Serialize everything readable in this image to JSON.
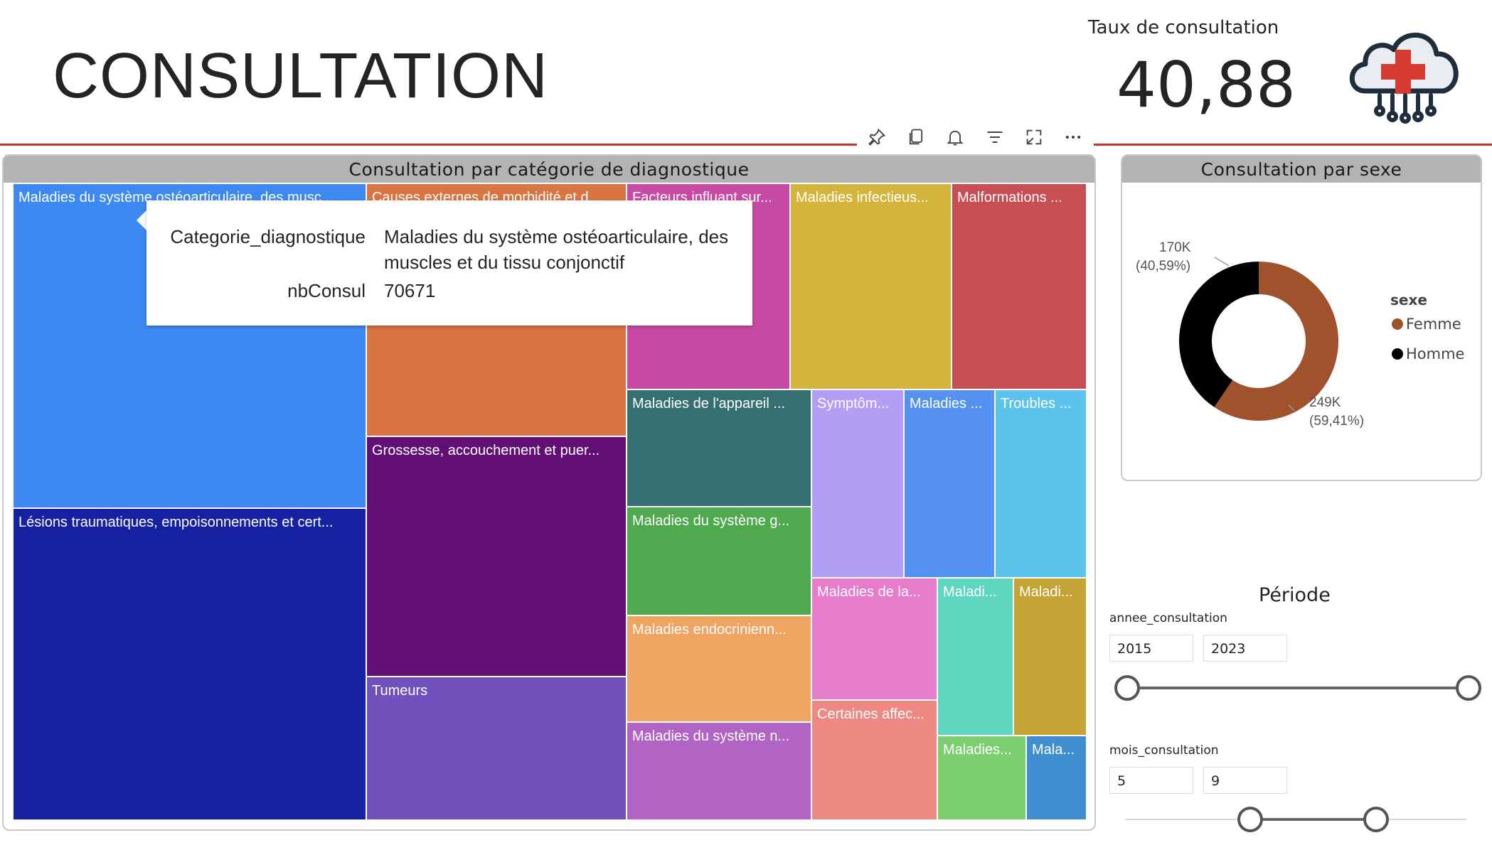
{
  "page": {
    "title": "CONSULTATION"
  },
  "kpi": {
    "label": "Taux de consultation",
    "value": "40,88"
  },
  "toolbar": {
    "icons": [
      "pin-icon",
      "copy-icon",
      "bell-icon",
      "filter-icon",
      "focus-mode-icon",
      "more-options-icon"
    ]
  },
  "treemap": {
    "title": "Consultation par catégorie de diagnostique",
    "cells": [
      {
        "label": "Maladies du système ostéoarticulaire, des musc...",
        "color": "#3d89f1"
      },
      {
        "label": "Lésions traumatiques, empoisonnements et cert...",
        "color": "#1521a1"
      },
      {
        "label": "Causes externes de morbidité et d...",
        "color": "#d97543"
      },
      {
        "label": "Grossesse, accouchement et puer...",
        "color": "#620f76"
      },
      {
        "label": "Tumeurs",
        "color": "#7152bc"
      },
      {
        "label": "Facteurs influant sur...",
        "color": "#c94aa5"
      },
      {
        "label": "Maladies infectieus...",
        "color": "#d4b53b"
      },
      {
        "label": "Malformations ...",
        "color": "#c74f53"
      },
      {
        "label": "Maladies de l'appareil ...",
        "color": "#356f72"
      },
      {
        "label": "Maladies du système g...",
        "color": "#4ea94f"
      },
      {
        "label": "Maladies endocrinienn...",
        "color": "#f0a462"
      },
      {
        "label": "Maladies du système n...",
        "color": "#b164c3"
      },
      {
        "label": "Symptôm...",
        "color": "#b29ff5"
      },
      {
        "label": "Maladies ...",
        "color": "#5591f0"
      },
      {
        "label": "Troubles ...",
        "color": "#5bc3ec"
      },
      {
        "label": "Maladies de la...",
        "color": "#e77ccd"
      },
      {
        "label": "Maladi...",
        "color": "#5fd6bf"
      },
      {
        "label": "Maladi...",
        "color": "#c3a333"
      },
      {
        "label": "Certaines affec...",
        "color": "#ee8882"
      },
      {
        "label": "Maladies...",
        "color": "#7ccf6f"
      },
      {
        "label": "Mala...",
        "color": "#3e8ed0"
      }
    ],
    "tooltip": {
      "field1_name": "Categorie_diagnostique",
      "field1_value_line1": "Maladies du système ostéoarticulaire, des",
      "field1_value_line2": "muscles et du tissu conjonctif",
      "field2_name": "nbConsul",
      "field2_value": "70671"
    }
  },
  "donut": {
    "title": "Consultation par sexe",
    "legend_title": "sexe",
    "labels": {
      "femme_value": "249K",
      "femme_pct": "(59,41%)",
      "homme_value": "170K",
      "homme_pct": "(40,59%)"
    },
    "chart_data": {
      "type": "pie",
      "categories": [
        "Femme",
        "Homme"
      ],
      "values": [
        249000,
        170000
      ],
      "percent": [
        59.41,
        40.59
      ],
      "colors": [
        "#a0522d",
        "#000000"
      ],
      "legend_position": "right"
    }
  },
  "slicer": {
    "title": "Période",
    "year": {
      "field": "annee_consultation",
      "from": "2015",
      "to": "2023"
    },
    "month": {
      "field": "mois_consultation",
      "from": "5",
      "to": "9"
    }
  }
}
